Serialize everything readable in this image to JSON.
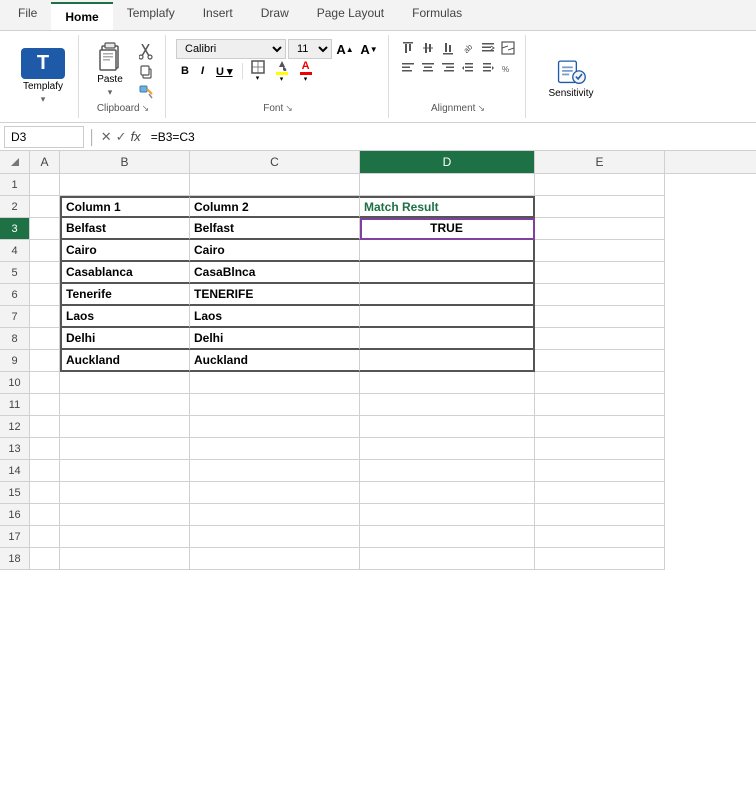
{
  "ribbon": {
    "tabs": [
      {
        "label": "File",
        "active": false
      },
      {
        "label": "Home",
        "active": true
      },
      {
        "label": "Templafy",
        "active": false
      },
      {
        "label": "Insert",
        "active": false
      },
      {
        "label": "Draw",
        "active": false
      },
      {
        "label": "Page Layout",
        "active": false
      },
      {
        "label": "Formulas",
        "active": false
      }
    ],
    "groups": {
      "templafy": {
        "label": "Templafy",
        "icon": "T"
      },
      "clipboard": {
        "label": "Clipboard",
        "paste": "Paste",
        "cut": "✂",
        "copy": "📋",
        "format_painter": "🖌"
      },
      "font": {
        "label": "Font",
        "name": "Calibri",
        "size": "11",
        "bold": "B",
        "italic": "I",
        "underline": "U"
      },
      "alignment": {
        "label": "Alignment"
      },
      "sensitivity": {
        "label": "Sensitivity"
      }
    }
  },
  "formula_bar": {
    "cell_ref": "D3",
    "formula": "=B3=C3"
  },
  "spreadsheet": {
    "col_headers": [
      "",
      "A",
      "B",
      "C",
      "D",
      "E"
    ],
    "active_col": "D",
    "active_row": 3,
    "rows": [
      {
        "row": 1,
        "cells": [
          "",
          "",
          "",
          "",
          ""
        ]
      },
      {
        "row": 2,
        "cells": [
          "",
          "Column 1",
          "Column 2",
          "Match Result",
          ""
        ]
      },
      {
        "row": 3,
        "cells": [
          "",
          "Belfast",
          "Belfast",
          "TRUE",
          ""
        ]
      },
      {
        "row": 4,
        "cells": [
          "",
          "Cairo",
          "Cairo",
          "",
          ""
        ]
      },
      {
        "row": 5,
        "cells": [
          "",
          "Casablanca",
          "CasaBlnca",
          "",
          ""
        ]
      },
      {
        "row": 6,
        "cells": [
          "",
          "Tenerife",
          "TENERIFE",
          "",
          ""
        ]
      },
      {
        "row": 7,
        "cells": [
          "",
          "Laos",
          "Laos",
          "",
          ""
        ]
      },
      {
        "row": 8,
        "cells": [
          "",
          "Delhi",
          "Delhi",
          "",
          ""
        ]
      },
      {
        "row": 9,
        "cells": [
          "",
          "Auckland",
          "Auckland",
          "",
          ""
        ]
      },
      {
        "row": 10,
        "cells": [
          "",
          "",
          "",
          "",
          ""
        ]
      },
      {
        "row": 11,
        "cells": [
          "",
          "",
          "",
          "",
          ""
        ]
      },
      {
        "row": 12,
        "cells": [
          "",
          "",
          "",
          "",
          ""
        ]
      },
      {
        "row": 13,
        "cells": [
          "",
          "",
          "",
          "",
          ""
        ]
      },
      {
        "row": 14,
        "cells": [
          "",
          "",
          "",
          "",
          ""
        ]
      },
      {
        "row": 15,
        "cells": [
          "",
          "",
          "",
          "",
          ""
        ]
      },
      {
        "row": 16,
        "cells": [
          "",
          "",
          "",
          "",
          ""
        ]
      },
      {
        "row": 17,
        "cells": [
          "",
          "",
          "",
          "",
          ""
        ]
      },
      {
        "row": 18,
        "cells": [
          "",
          "",
          "",
          "",
          ""
        ]
      }
    ]
  }
}
